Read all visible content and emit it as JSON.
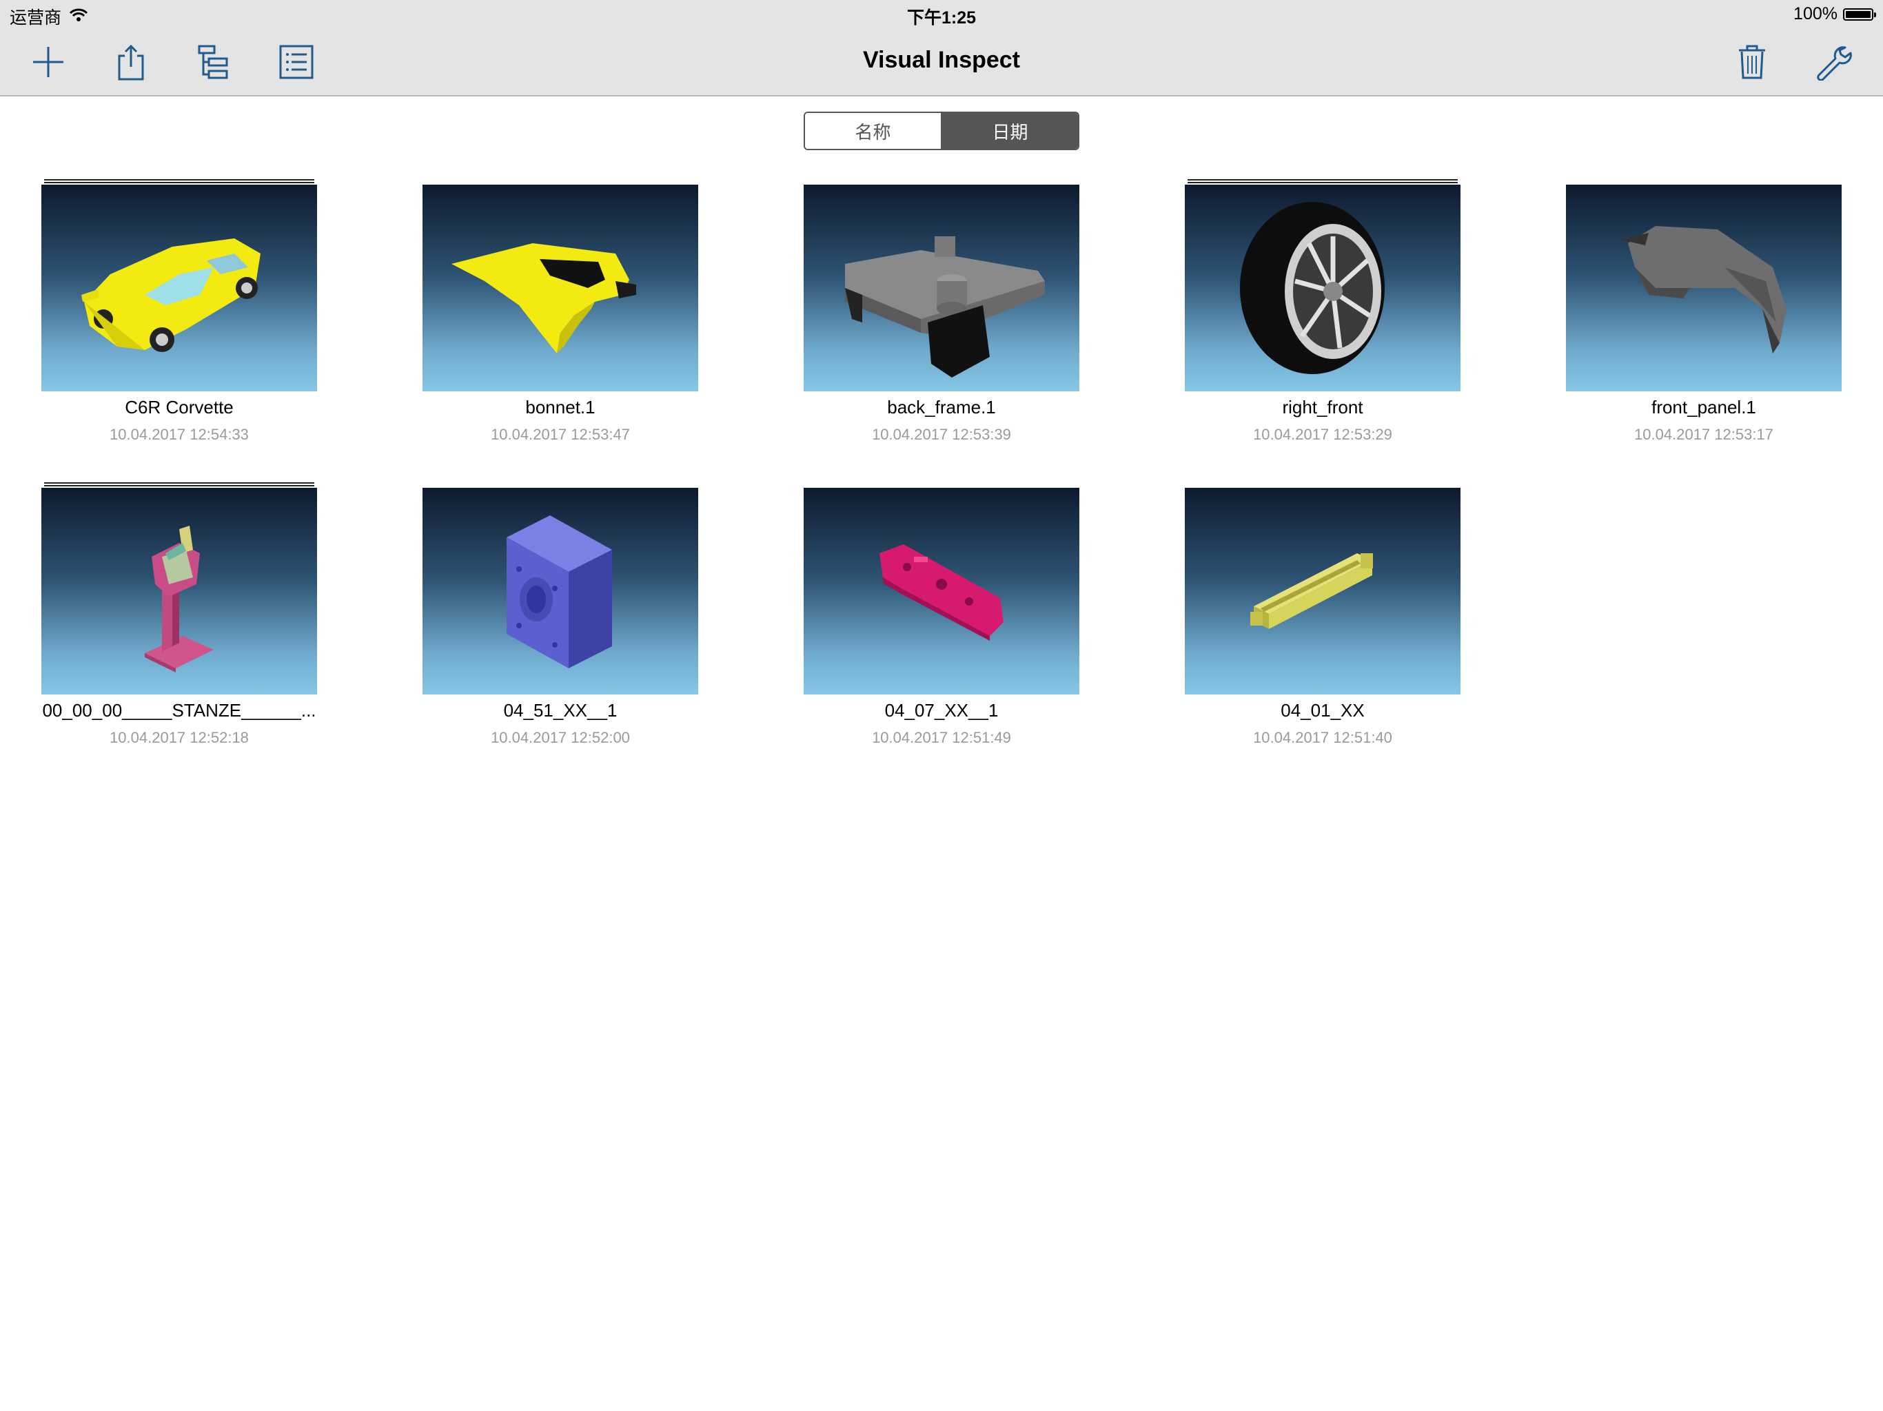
{
  "status_bar": {
    "carrier": "运营商",
    "time": "下午1:25",
    "battery": "100%"
  },
  "nav": {
    "title": "Visual Inspect",
    "icons": [
      "plus-icon",
      "share-icon",
      "tree-icon",
      "list-icon",
      "trash-icon",
      "wrench-icon"
    ],
    "accent_color": "#1f5b8f"
  },
  "sort_control": {
    "options": [
      "名称",
      "日期"
    ],
    "selected": "日期"
  },
  "files": [
    {
      "name": "C6R Corvette",
      "date": "10.04.2017 12:54:33",
      "stacked": true,
      "model": "car",
      "color": "#f2ea10"
    },
    {
      "name": "bonnet.1",
      "date": "10.04.2017 12:53:47",
      "stacked": false,
      "model": "bonnet",
      "color": "#f2ea10"
    },
    {
      "name": "back_frame.1",
      "date": "10.04.2017 12:53:39",
      "stacked": false,
      "model": "frame",
      "color": "#808080"
    },
    {
      "name": "right_front",
      "date": "10.04.2017 12:53:29",
      "stacked": true,
      "model": "wheel",
      "color": "#111111"
    },
    {
      "name": "front_panel.1",
      "date": "10.04.2017 12:53:17",
      "stacked": false,
      "model": "panel",
      "color": "#6f6f6f"
    },
    {
      "name": "00_00_00_____STANZE______...",
      "date": "10.04.2017 12:52:18",
      "stacked": true,
      "model": "stand",
      "color": "#d0558d"
    },
    {
      "name": "04_51_XX__1",
      "date": "10.04.2017 12:52:00",
      "stacked": false,
      "model": "block",
      "color": "#5b5fd0"
    },
    {
      "name": "04_07_XX__1",
      "date": "10.04.2017 12:51:49",
      "stacked": false,
      "model": "bar",
      "color": "#d81a6e"
    },
    {
      "name": "04_01_XX",
      "date": "10.04.2017 12:51:40",
      "stacked": false,
      "model": "rail",
      "color": "#d6d45a"
    }
  ]
}
